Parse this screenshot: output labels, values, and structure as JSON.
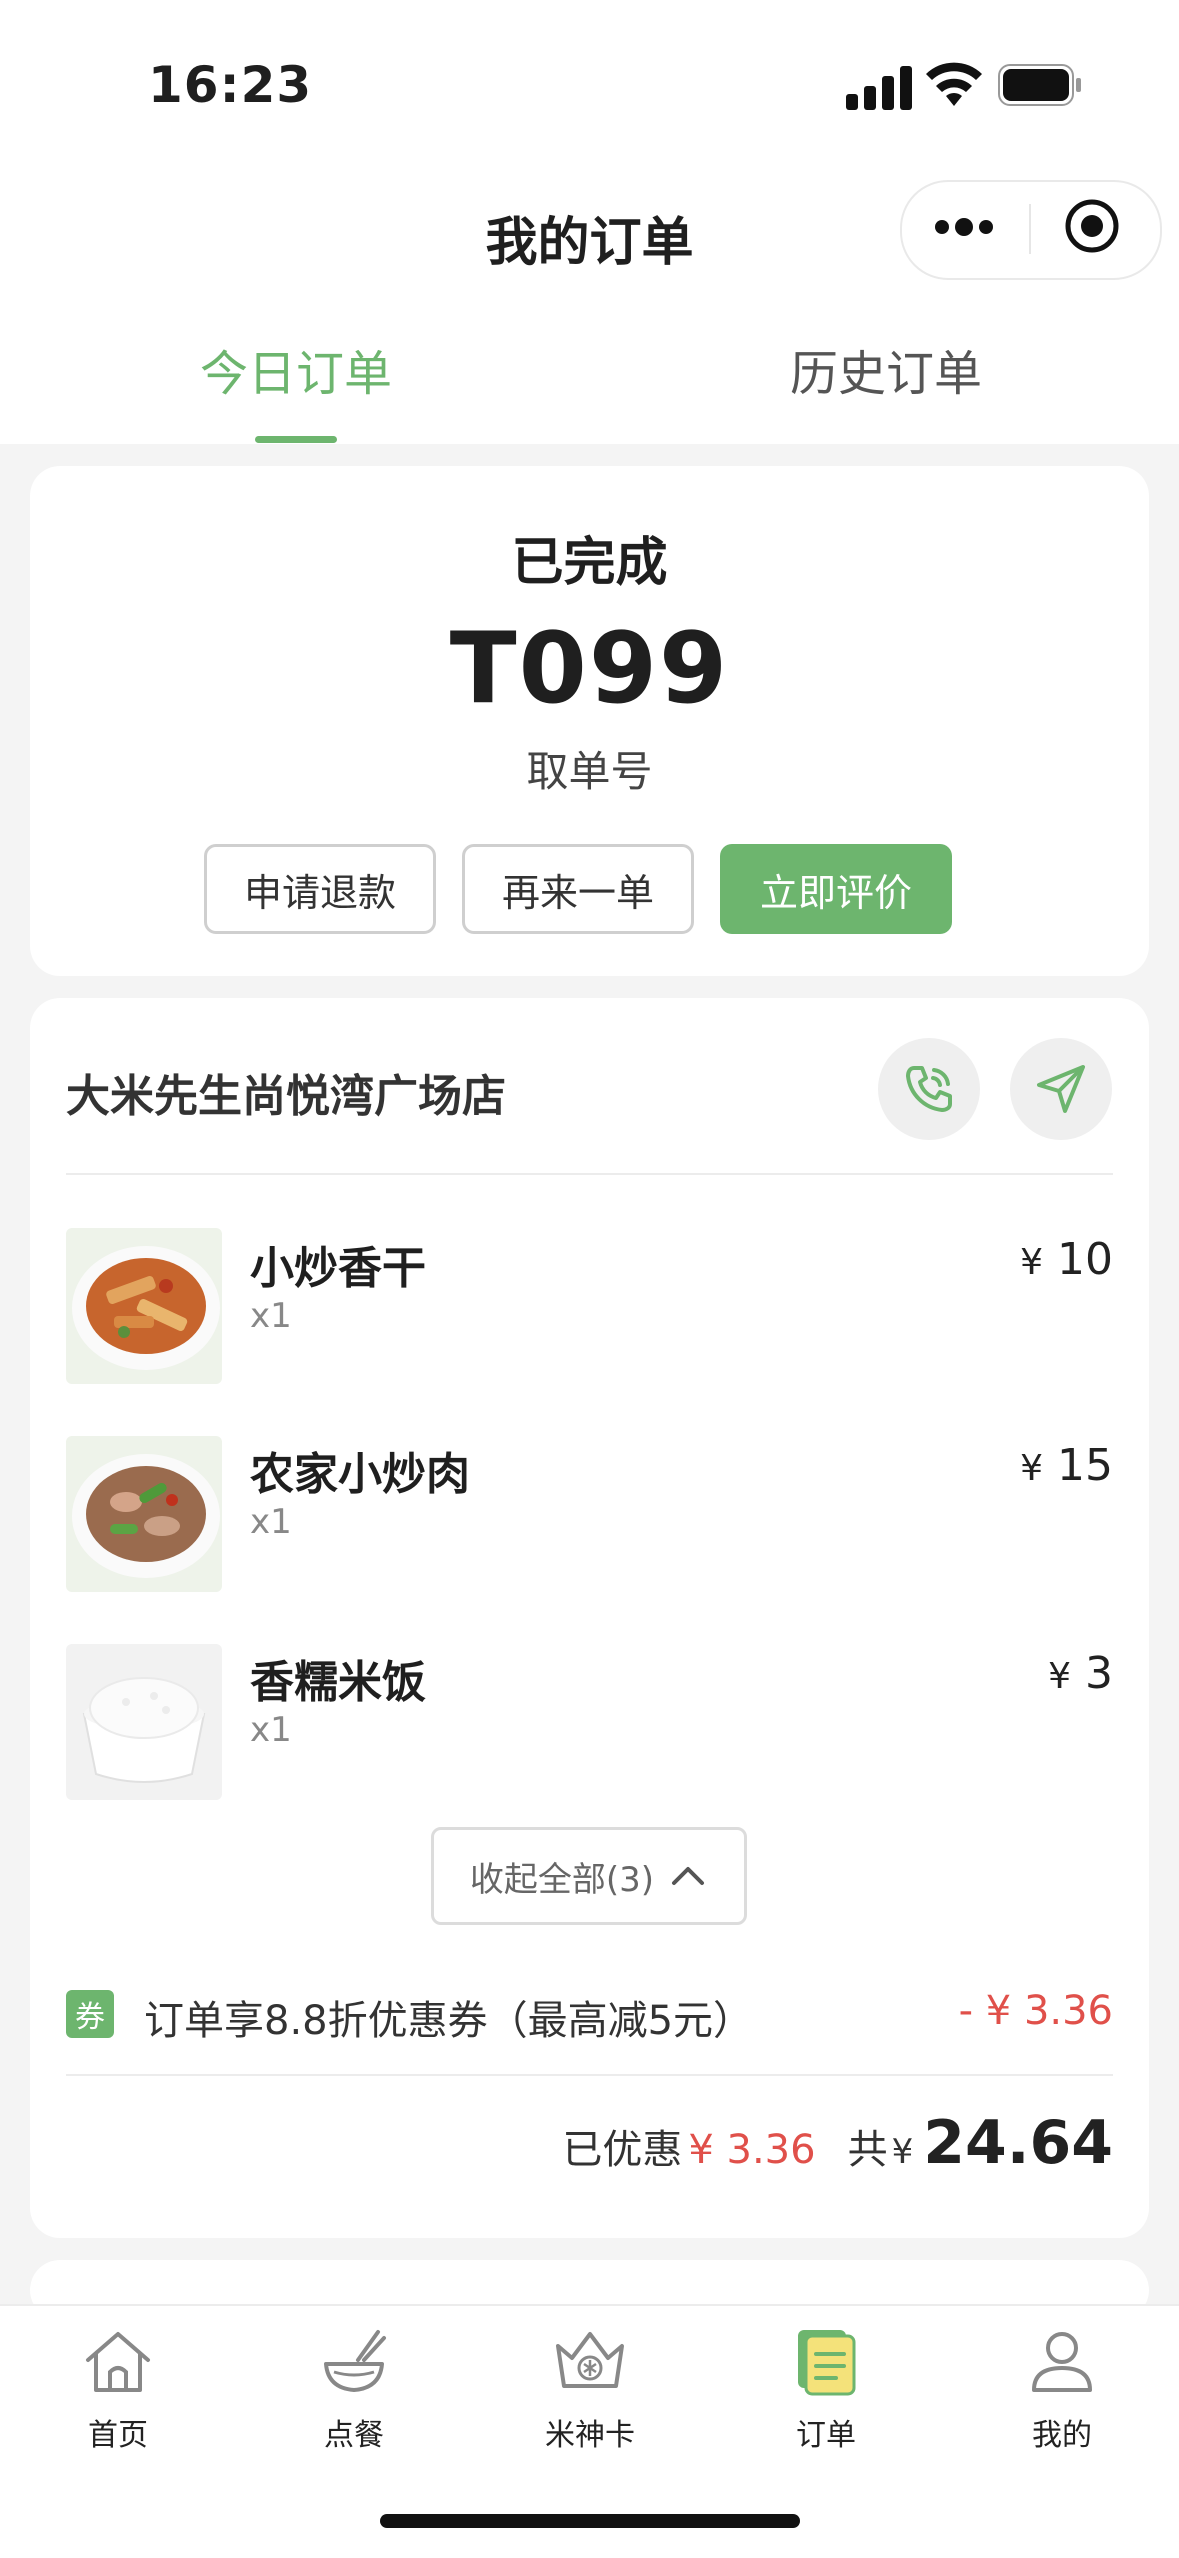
{
  "status_bar": {
    "time": "16:23"
  },
  "nav": {
    "title": "我的订单"
  },
  "tabs": [
    {
      "label": "今日订单",
      "active": true
    },
    {
      "label": "历史订单",
      "active": false
    }
  ],
  "order_status": {
    "status": "已完成",
    "pickup_code": "T099",
    "pickup_label": "取单号",
    "actions": {
      "refund": "申请退款",
      "reorder": "再来一单",
      "rate": "立即评价"
    }
  },
  "store": {
    "name": "大米先生尚悦湾广场店",
    "icons": [
      "phone-icon",
      "navigation-icon"
    ]
  },
  "items": [
    {
      "name": "小炒香干",
      "qty": "x1",
      "currency": "¥",
      "price": "10"
    },
    {
      "name": "农家小炒肉",
      "qty": "x1",
      "currency": "¥",
      "price": "15"
    },
    {
      "name": "香糯米饭",
      "qty": "x1",
      "currency": "¥",
      "price": "3"
    }
  ],
  "collapse_label": "收起全部(3)",
  "coupon": {
    "badge": "券",
    "text": "订单享8.8折优惠券（最高减5元）",
    "amount": "- ¥ 3.36"
  },
  "totals": {
    "saved_label": "已优惠",
    "saved_amount": "¥ 3.36",
    "total_label": "共",
    "total_currency": "¥",
    "total_amount": "24.64"
  },
  "bottom_tabs": [
    {
      "label": "首页",
      "icon": "home-icon"
    },
    {
      "label": "点餐",
      "icon": "bowl-icon"
    },
    {
      "label": "米神卡",
      "icon": "crown-card-icon"
    },
    {
      "label": "订单",
      "icon": "order-list-icon",
      "active": true
    },
    {
      "label": "我的",
      "icon": "profile-icon"
    }
  ],
  "colors": {
    "accent": "#6db56e",
    "discount": "#e0504a",
    "background": "#f4f4f4"
  }
}
